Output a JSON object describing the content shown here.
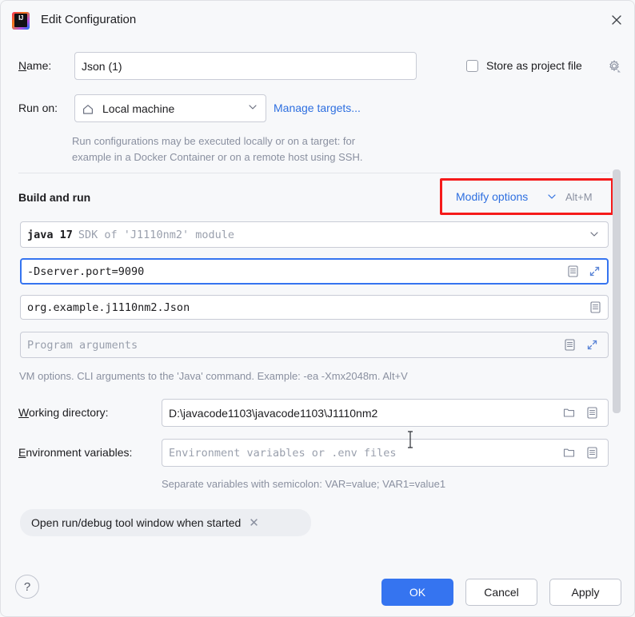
{
  "window": {
    "title": "Edit Configuration",
    "logo_icon": "intellij-idea-logo",
    "close_icon": "close-icon"
  },
  "name_row": {
    "label": "Name:",
    "value": "Json (1)"
  },
  "store_as_project_file": {
    "label": "Store as project file",
    "checked": false,
    "gear_icon": "gear-icon"
  },
  "run_on_row": {
    "label": "Run on:",
    "selected": "Local machine",
    "home_icon": "home-icon",
    "chevron_icon": "chevron-down-icon",
    "manage_targets_link": "Manage targets...",
    "description_line1": "Run configurations may be executed locally or on a target: for",
    "description_line2": "example in a Docker Container or on a remote host using SSH."
  },
  "build_and_run": {
    "section_title": "Build and run",
    "modify_options_label": "Modify options",
    "modify_options_chevron": "chevron-down-icon",
    "modify_options_shortcut": "Alt+M",
    "highlight_color": "#f51a1a",
    "jdk_combo": {
      "primary": "java 17",
      "secondary": "SDK of 'J1110nm2' module",
      "chevron_icon": "chevron-down-icon"
    },
    "vm_options_field": {
      "value": "-Dserver.port=9090",
      "focused": true,
      "list_icon": "document-list-icon",
      "expand_icon": "expand-diagonal-icon"
    },
    "main_class_field": {
      "value": "org.example.j1110nm2.Json",
      "list_icon": "document-list-icon"
    },
    "program_arguments_field": {
      "placeholder": "Program arguments",
      "value": "",
      "list_icon": "document-list-icon",
      "expand_icon": "expand-diagonal-icon"
    },
    "vm_hint": "VM options. CLI arguments to the 'Java' command. Example: -ea -Xmx2048m. Alt+V"
  },
  "working_directory": {
    "label": "Working directory:",
    "value": "D:\\javacode1103\\javacode1103\\J1110nm2",
    "folder_icon": "folder-icon",
    "list_icon": "document-list-icon"
  },
  "environment_variables": {
    "label": "Environment variables:",
    "placeholder": "Environment variables or .env files",
    "value": "",
    "folder_icon": "folder-icon",
    "list_icon": "document-list-icon",
    "hint": "Separate variables with semicolon: VAR=value; VAR1=value1"
  },
  "option_chip": {
    "label": "Open run/debug tool window when started",
    "remove_icon": "close-icon"
  },
  "footer": {
    "help_label": "?",
    "ok_label": "OK",
    "cancel_label": "Cancel",
    "apply_label": "Apply",
    "primary_color": "#3574f0"
  }
}
